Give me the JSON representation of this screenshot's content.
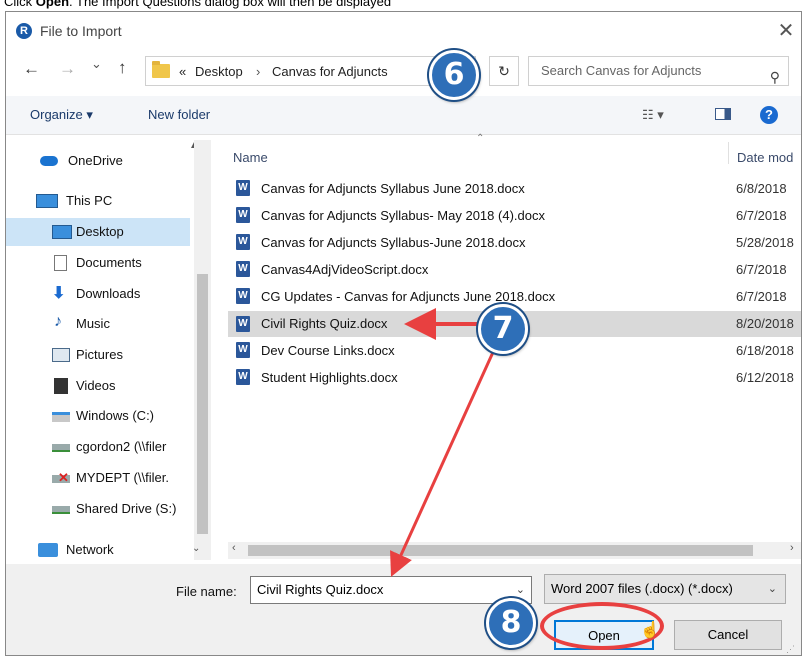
{
  "instruction": {
    "prefix": "Click ",
    "bold": "Open",
    "suffix": ". The Import Questions dialog box will then be displayed"
  },
  "dialog": {
    "title": "File to Import",
    "app_icon_letter": "R",
    "close_glyph": "✕"
  },
  "address": {
    "back": "←",
    "forward": "→",
    "recent": "⌄",
    "up": "↑",
    "overflow": "«",
    "crumbs": [
      "Desktop",
      "Canvas for Adjuncts"
    ],
    "separator": "›",
    "dropdown": "⌄",
    "refresh": "↻"
  },
  "search": {
    "placeholder": "Search Canvas for Adjuncts",
    "icon": "search-icon"
  },
  "toolbar": {
    "organize": "Organize ▾",
    "new_folder": "New folder",
    "view_glyph": "☷ ▾",
    "help": "?"
  },
  "nav": {
    "items": [
      {
        "label": "OneDrive",
        "icon": "onedrive-icon"
      },
      {
        "label": "This PC",
        "icon": "pc-icon"
      },
      {
        "label": "Desktop",
        "icon": "desktop-icon",
        "selected": true
      },
      {
        "label": "Documents",
        "icon": "documents-icon"
      },
      {
        "label": "Downloads",
        "icon": "downloads-icon"
      },
      {
        "label": "Music",
        "icon": "music-icon"
      },
      {
        "label": "Pictures",
        "icon": "pictures-icon"
      },
      {
        "label": "Videos",
        "icon": "videos-icon"
      },
      {
        "label": "Windows (C:)",
        "icon": "drive-icon"
      },
      {
        "label": "cgordon2 (\\\\filer",
        "icon": "network-drive-icon"
      },
      {
        "label": "MYDEPT (\\\\filer.",
        "icon": "disconnected-drive-icon"
      },
      {
        "label": "Shared Drive (S:)",
        "icon": "network-drive-icon"
      },
      {
        "label": "Network",
        "icon": "network-icon"
      }
    ]
  },
  "files": {
    "columns": {
      "name": "Name",
      "date": "Date mod"
    },
    "rows": [
      {
        "name": "Canvas for Adjuncts Syllabus June 2018.docx",
        "date": "6/8/2018"
      },
      {
        "name": "Canvas for Adjuncts Syllabus- May 2018 (4).docx",
        "date": "6/7/2018"
      },
      {
        "name": "Canvas for Adjuncts Syllabus-June 2018.docx",
        "date": "5/28/2018"
      },
      {
        "name": "Canvas4AdjVideoScript.docx",
        "date": "6/7/2018"
      },
      {
        "name": "CG Updates - Canvas for Adjuncts June 2018.docx",
        "date": "6/7/2018"
      },
      {
        "name": "Civil Rights Quiz.docx",
        "date": "8/20/2018",
        "selected": true
      },
      {
        "name": "Dev Course Links.docx",
        "date": "6/18/2018"
      },
      {
        "name": "Student Highlights.docx",
        "date": "6/12/2018"
      }
    ]
  },
  "bottom": {
    "file_name_label": "File name:",
    "file_name_value": "Civil Rights Quiz.docx",
    "file_type": "Word 2007 files (.docx) (*.docx)",
    "open": "Open",
    "cancel": "Cancel"
  },
  "callouts": {
    "step6": "6",
    "step7": "7",
    "step8": "8"
  },
  "colors": {
    "accent": "#2e6fb8",
    "arrow": "#e84040",
    "selection": "#cce4f7"
  }
}
